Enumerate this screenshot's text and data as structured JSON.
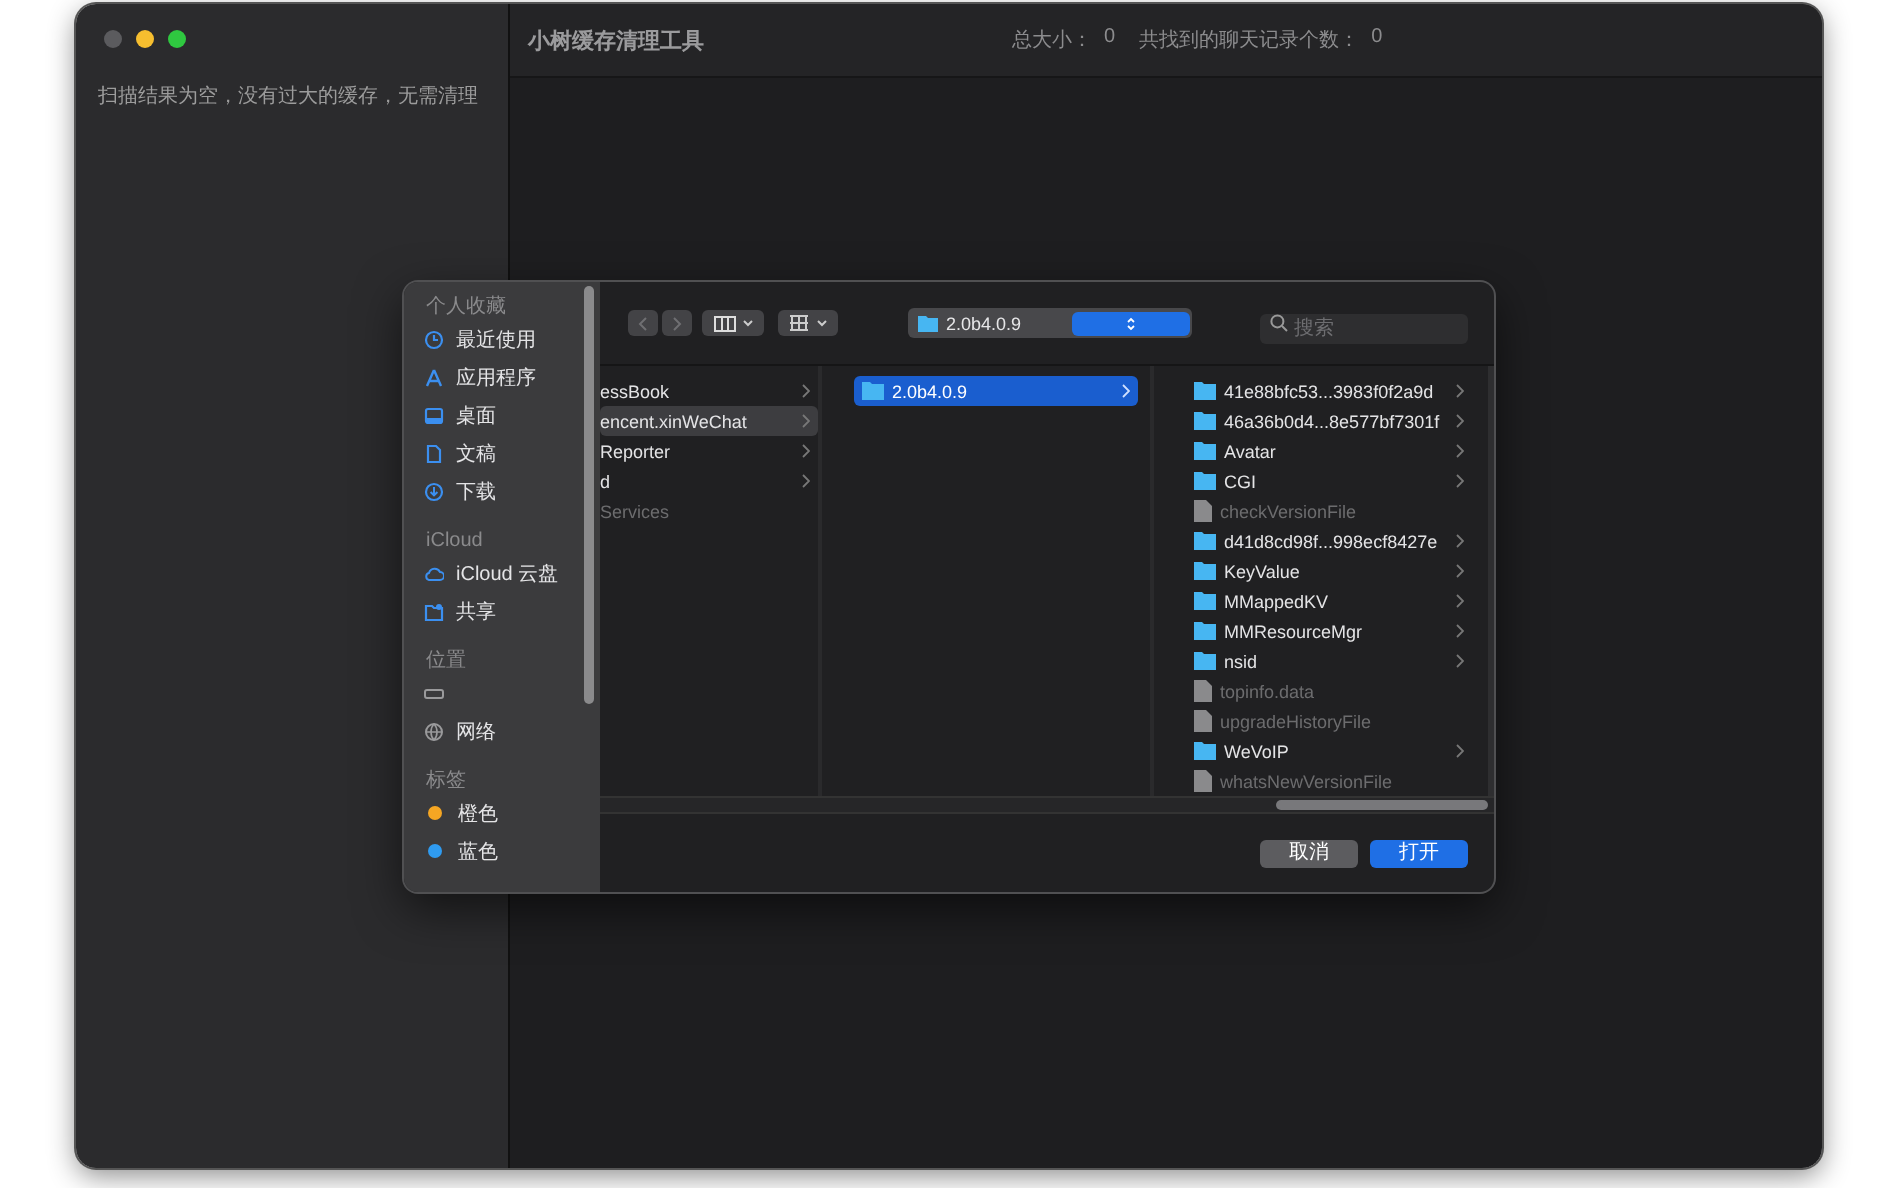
{
  "window": {
    "title": "小树缓存清理工具",
    "stats": [
      {
        "label": "总大小：",
        "value": "0"
      },
      {
        "label": "共找到的聊天记录个数：",
        "value": "0"
      }
    ]
  },
  "sidebar": {
    "message": "扫描结果为空，没有过大的缓存，无需清理"
  },
  "dialog": {
    "sidebar": [
      {
        "heading": "个人收藏",
        "items": [
          {
            "kind": "recent",
            "label": "最近使用"
          },
          {
            "kind": "apps",
            "label": "应用程序"
          },
          {
            "kind": "desktop",
            "label": "桌面"
          },
          {
            "kind": "document",
            "label": "文稿"
          },
          {
            "kind": "download",
            "label": "下载"
          }
        ]
      },
      {
        "heading": "iCloud",
        "items": [
          {
            "kind": "cloud",
            "label": "iCloud 云盘"
          },
          {
            "kind": "shared",
            "label": "共享"
          }
        ]
      },
      {
        "heading": "位置",
        "items": [
          {
            "kind": "drive"
          },
          {
            "kind": "network",
            "label": "网络"
          }
        ]
      },
      {
        "heading": "标签",
        "items": [
          {
            "kind": "tag",
            "label": "橙色",
            "color": "#f5a623"
          },
          {
            "kind": "tag",
            "label": "蓝色",
            "color": "#2f9bf0"
          }
        ]
      }
    ],
    "path": "2.0b4.0.9",
    "search": {
      "placeholder": "搜索"
    },
    "columns": [
      {
        "cut": true,
        "focused": false,
        "items": [
          {
            "kind": "folder",
            "label": "essBook",
            "selected": false
          },
          {
            "kind": "folder",
            "label": "encent.xinWeChat",
            "selected": true
          },
          {
            "kind": "folder",
            "label": "Reporter",
            "selected": false
          },
          {
            "kind": "folder",
            "label": "d",
            "selected": false
          },
          {
            "kind": "file",
            "label": "Services",
            "selected": false
          }
        ]
      },
      {
        "cut": false,
        "focused": true,
        "items": [
          {
            "kind": "folder",
            "label": "2.0b4.0.9",
            "selected": true
          }
        ]
      },
      {
        "cut": false,
        "items": [
          {
            "kind": "folder",
            "label": "41e88bfc53...3983f0f2a9d",
            "selected": false
          },
          {
            "kind": "folder",
            "label": "46a36b0d4...8e577bf7301f",
            "selected": false
          },
          {
            "kind": "folder",
            "label": "Avatar",
            "selected": false
          },
          {
            "kind": "folder",
            "label": "CGI",
            "selected": false
          },
          {
            "kind": "file",
            "label": "checkVersionFile",
            "selected": false
          },
          {
            "kind": "folder",
            "label": "d41d8cd98f...998ecf8427e",
            "selected": false
          },
          {
            "kind": "folder",
            "label": "KeyValue",
            "selected": false
          },
          {
            "kind": "folder",
            "label": "MMappedKV",
            "selected": false
          },
          {
            "kind": "folder",
            "label": "MMResourceMgr",
            "selected": false
          },
          {
            "kind": "folder",
            "label": "nsid",
            "selected": false
          },
          {
            "kind": "file",
            "label": "topinfo.data",
            "selected": false
          },
          {
            "kind": "file",
            "label": "upgradeHistoryFile",
            "selected": false
          },
          {
            "kind": "folder",
            "label": "WeVoIP",
            "selected": false
          },
          {
            "kind": "file",
            "label": "whatsNewVersionFile",
            "selected": false
          }
        ]
      }
    ],
    "buttons": [
      {
        "kind": "secondary",
        "label": "取消"
      },
      {
        "kind": "primary",
        "label": "打开"
      }
    ]
  }
}
